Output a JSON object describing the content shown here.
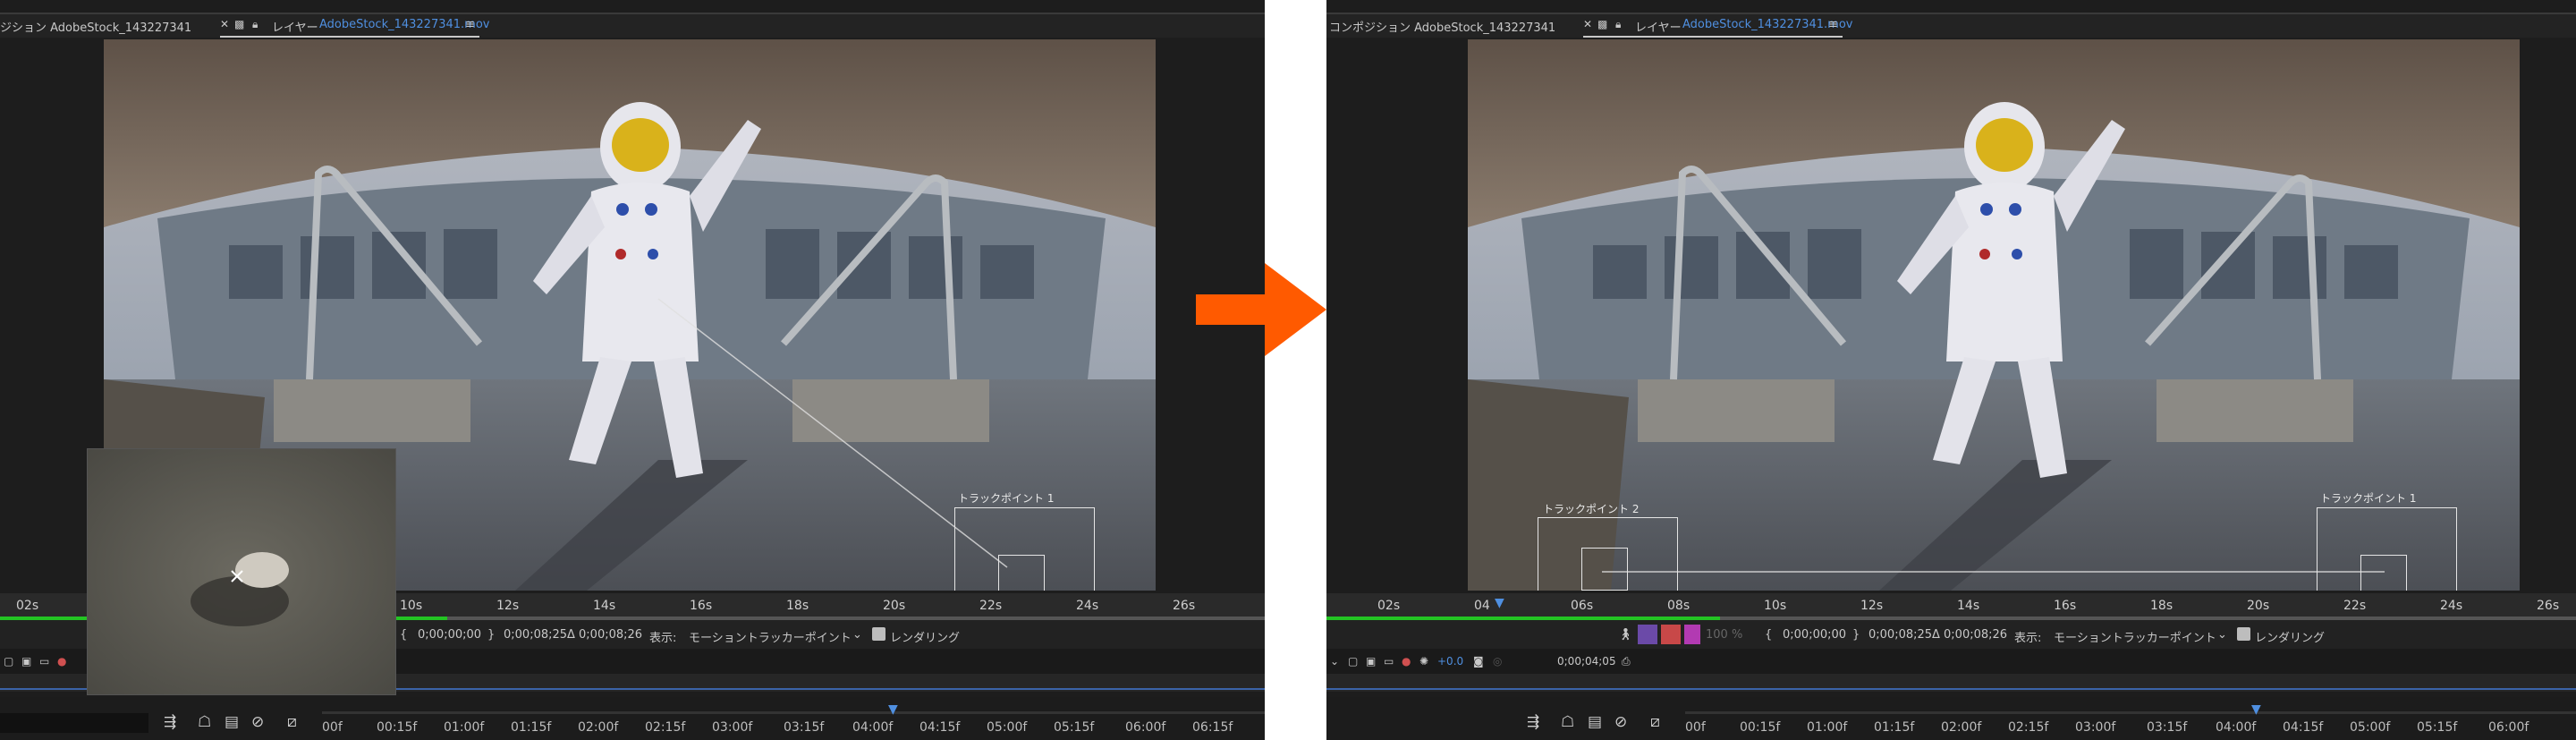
{
  "colors": {
    "accent_blue": "#4f8fe0",
    "arrow_orange": "#ff5a00",
    "green_bar": "#23c423"
  },
  "left": {
    "tabs": {
      "comp_tab_label": "ジション AdobeStock_143227341",
      "layer_prefix": "レイヤー",
      "layer_name": "AdobeStock_143227341.mov"
    },
    "ruler_labels": [
      "02s",
      "10s",
      "12s",
      "14s",
      "16s",
      "18s",
      "20s",
      "22s",
      "24s",
      "26s"
    ],
    "track_point_1": "トラックポイント 1",
    "controls": {
      "in_time": "0;00;00;00",
      "out_time": "0;00;08;25",
      "duration": "Δ 0;00;08;26",
      "view_label": "表示:",
      "view_value": "モーショントラッカーポイント",
      "render_label": "レンダリング"
    },
    "timeline_ticks": [
      "00f",
      "00:15f",
      "01:00f",
      "01:15f",
      "02:00f",
      "02:15f",
      "03:00f",
      "03:15f",
      "04:00f",
      "04:15f",
      "05:00f",
      "05:15f",
      "06:00f",
      "06:15f"
    ]
  },
  "right": {
    "tabs": {
      "comp_tab_label": "コンポジション AdobeStock_143227341",
      "layer_prefix": "レイヤー",
      "layer_name": "AdobeStock_143227341.mov"
    },
    "ruler_labels": [
      "02s",
      "04",
      "06s",
      "08s",
      "10s",
      "12s",
      "14s",
      "16s",
      "18s",
      "20s",
      "22s",
      "24s",
      "26s"
    ],
    "track_point_1": "トラックポイント 1",
    "track_point_2": "トラックポイント 2",
    "controls": {
      "opacity": "100 %",
      "in_time": "0;00;00;00",
      "out_time": "0;00;08;25",
      "duration": "Δ 0;00;08;26",
      "view_label": "表示:",
      "view_value": "モーショントラッカーポイント",
      "render_label": "レンダリング"
    },
    "subbar": {
      "exposure": "+0.0",
      "timecode": "0;00;04;05"
    },
    "timeline_ticks": [
      "00f",
      "00:15f",
      "01:00f",
      "01:15f",
      "02:00f",
      "02:15f",
      "03:00f",
      "03:15f",
      "04:00f",
      "04:15f",
      "05:00f",
      "05:15f",
      "06:00f"
    ]
  }
}
